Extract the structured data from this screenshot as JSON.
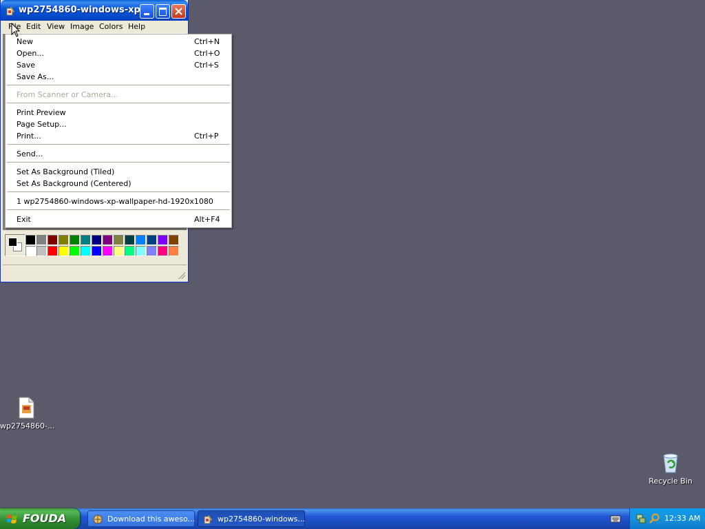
{
  "window": {
    "title": "wp2754860-windows-xp-...",
    "menubar": [
      "File",
      "Edit",
      "View",
      "Image",
      "Colors",
      "Help"
    ]
  },
  "file_menu": {
    "items": [
      {
        "label": "New",
        "shortcut": "Ctrl+N"
      },
      {
        "label": "Open...",
        "shortcut": "Ctrl+O"
      },
      {
        "label": "Save",
        "shortcut": "Ctrl+S"
      },
      {
        "label": "Save As...",
        "shortcut": ""
      },
      {
        "label": "From Scanner or Camera...",
        "shortcut": "",
        "disabled": true
      },
      {
        "label": "Print Preview",
        "shortcut": ""
      },
      {
        "label": "Page Setup...",
        "shortcut": ""
      },
      {
        "label": "Print...",
        "shortcut": "Ctrl+P"
      },
      {
        "label": "Send...",
        "shortcut": ""
      },
      {
        "label": "Set As Background (Tiled)",
        "shortcut": ""
      },
      {
        "label": "Set As Background (Centered)",
        "shortcut": ""
      },
      {
        "label": "1 wp2754860-windows-xp-wallpaper-hd-1920x1080",
        "shortcut": ""
      },
      {
        "label": "Exit",
        "shortcut": "Alt+F4"
      }
    ]
  },
  "palette": {
    "row1": [
      "#000000",
      "#808080",
      "#800000",
      "#808000",
      "#008000",
      "#008080",
      "#000080",
      "#800080",
      "#808040",
      "#004040",
      "#0080ff",
      "#004080",
      "#8000ff",
      "#804000"
    ],
    "row2": [
      "#ffffff",
      "#c0c0c0",
      "#ff0000",
      "#ffff00",
      "#00ff00",
      "#00ffff",
      "#0000ff",
      "#ff00ff",
      "#ffff80",
      "#00ff80",
      "#80ffff",
      "#8080ff",
      "#ff0080",
      "#ff8040"
    ]
  },
  "desktop": {
    "file_icon_label": "wp2754860-...",
    "recycle_bin_label": "Recycle Bin"
  },
  "taskbar": {
    "start_label": "FOUDA",
    "buttons": [
      {
        "label": "Download this aweso...",
        "active": false
      },
      {
        "label": "wp2754860-windows...",
        "active": true
      }
    ],
    "clock": "12:33 AM"
  },
  "colors": {
    "desktop_bg": "#5a5a6b",
    "titlebar": "#0758d6",
    "taskbar": "#2157d7",
    "start": "#3c9a3c"
  }
}
